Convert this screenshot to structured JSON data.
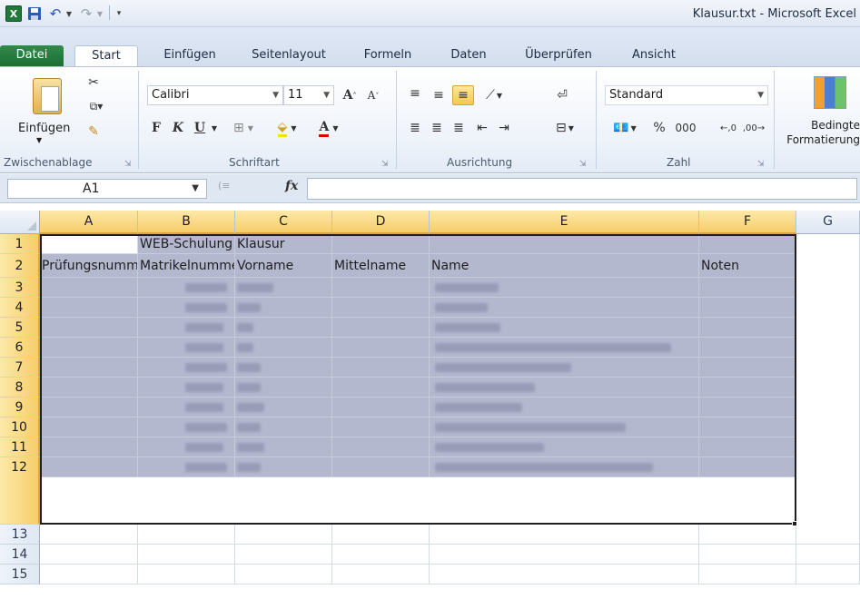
{
  "window": {
    "app_logo": "X",
    "title": "Klausur.txt - Microsoft Excel"
  },
  "quick_access": {
    "save_icon": "save-icon",
    "undo_icon": "undo-icon",
    "redo_icon": "redo-icon"
  },
  "tabs": [
    "Datei",
    "Start",
    "Einfügen",
    "Seitenlayout",
    "Formeln",
    "Daten",
    "Überprüfen",
    "Ansicht"
  ],
  "ribbon": {
    "paste_label": "Einfügen",
    "groups": {
      "clipboard": "Zwischenablage",
      "font": "Schriftart",
      "alignment": "Ausrichtung",
      "number": "Zahl"
    },
    "font_name": "Calibri",
    "font_size": "11",
    "bold": "F",
    "italic": "K",
    "underline": "U",
    "number_format": "Standard",
    "percent": "%",
    "thousands": "000",
    "cond_format": "Bedingte Formatierung"
  },
  "formula_bar": {
    "name_box": "A1",
    "fx": "fx",
    "formula": ""
  },
  "grid": {
    "columns": [
      "A",
      "B",
      "C",
      "D",
      "E",
      "F",
      "G"
    ],
    "rows": [
      "1",
      "2",
      "3",
      "4",
      "5",
      "6",
      "7",
      "8",
      "9",
      "10",
      "11",
      "12",
      "13",
      "14",
      "15"
    ],
    "row1": {
      "B": "WEB-Schulung",
      "C": "Klausur"
    },
    "row2": {
      "A": "Prüfungsnummer",
      "B": "Matrikelnummer",
      "C": "Vorname",
      "D": "Mittelname",
      "E": "Name",
      "F": "Noten"
    }
  }
}
